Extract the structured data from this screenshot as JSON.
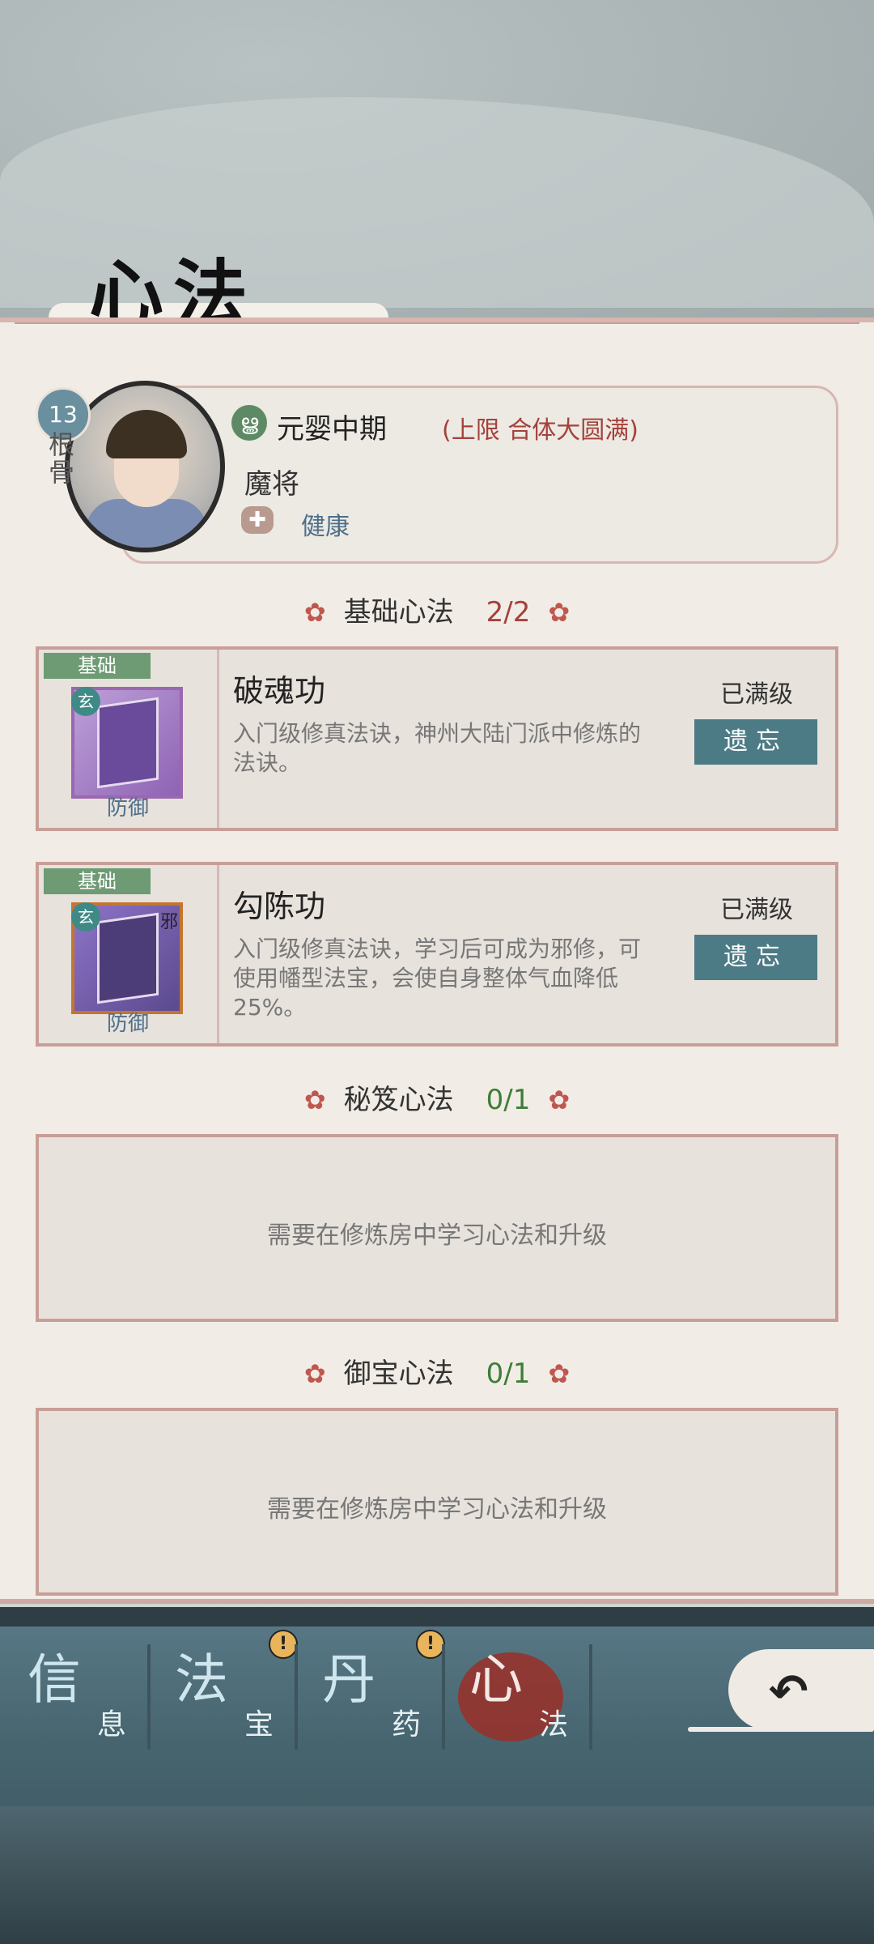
{
  "page_title": "心法",
  "character": {
    "level": "13",
    "root_label": "根骨",
    "realm": "元婴中期",
    "limit": "(上限 合体大圆满)",
    "role": "魔将",
    "health": "健康"
  },
  "sections": {
    "basic": {
      "label": "基础心法",
      "count": "2/2"
    },
    "secret": {
      "label": "秘笈心法",
      "count": "0/1"
    },
    "treasure": {
      "label": "御宝心法",
      "count": "0/1"
    }
  },
  "skills": [
    {
      "tag": "基础",
      "name": "破魂功",
      "desc": "入门级修真法诀，神州大陆门派中修炼的法诀。",
      "type": "防御",
      "status": "已满级",
      "button": "遗忘",
      "badge": "玄"
    },
    {
      "tag": "基础",
      "name": "勾陈功",
      "desc": "入门级修真法诀，学习后可成为邪修，可使用幡型法宝，会使自身整体气血降低25%。",
      "type": "防御",
      "status": "已满级",
      "button": "遗忘",
      "badge": "玄",
      "badge2": "邪"
    }
  ],
  "empty_message": "需要在修炼房中学习心法和升级",
  "nav": [
    {
      "big": "信",
      "small": "息"
    },
    {
      "big": "法",
      "small": "宝"
    },
    {
      "big": "丹",
      "small": "药"
    },
    {
      "big": "心",
      "small": "法"
    }
  ],
  "colors": {
    "accent_red": "#a4413b",
    "teal": "#4c7b86",
    "green": "#3e7d38"
  }
}
